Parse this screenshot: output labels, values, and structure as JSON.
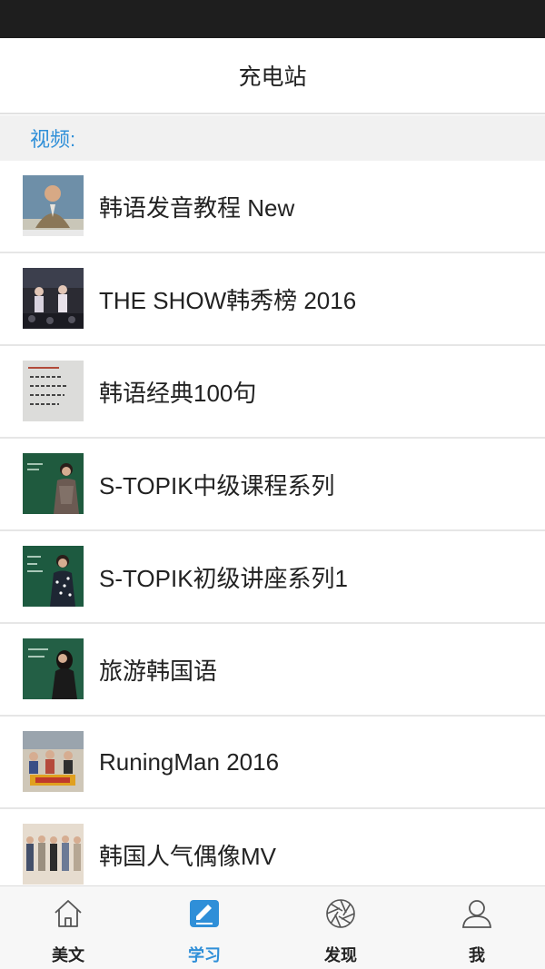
{
  "app": {
    "title": "充电站"
  },
  "section": {
    "label": "视频:"
  },
  "videos": [
    {
      "title": "韩语发音教程 New",
      "thumb_icon": "presenter-thumbnail"
    },
    {
      "title": "THE SHOW韩秀榜 2016",
      "thumb_icon": "stage-performance-thumbnail"
    },
    {
      "title": "韩语经典100句",
      "thumb_icon": "handwritten-notes-thumbnail"
    },
    {
      "title": "S-TOPIK中级课程系列",
      "thumb_icon": "teacher-blackboard-thumbnail"
    },
    {
      "title": "S-TOPIK初级讲座系列1",
      "thumb_icon": "teacher-blackboard-thumbnail"
    },
    {
      "title": "旅游韩国语",
      "thumb_icon": "teacher-blackboard-thumbnail"
    },
    {
      "title": "RuningMan 2016",
      "thumb_icon": "variety-show-thumbnail"
    },
    {
      "title": "韩国人气偶像MV",
      "thumb_icon": "idol-group-thumbnail"
    }
  ],
  "tabs": [
    {
      "label": "美文",
      "icon": "home-icon",
      "active": false
    },
    {
      "label": "学习",
      "icon": "edit-note-icon",
      "active": true
    },
    {
      "label": "发现",
      "icon": "aperture-icon",
      "active": false
    },
    {
      "label": "我",
      "icon": "user-icon",
      "active": false
    }
  ],
  "colors": {
    "accent": "#2f8fd8",
    "status_bar": "#1e1e1e",
    "section_bg": "#f1f1f1",
    "tab_bar_bg": "#f7f7f7"
  }
}
